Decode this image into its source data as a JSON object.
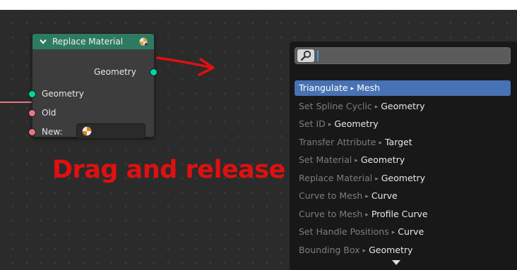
{
  "node": {
    "title": "Replace Material",
    "output_geometry": "Geometry",
    "input_geometry": "Geometry",
    "input_old": "Old",
    "input_new": "New:",
    "header_color": "#2e7b62",
    "geometry_socket_color": "#00d6a3",
    "material_socket_color": "#eb7582"
  },
  "annotation": {
    "text": "Drag and release",
    "color": "#e01010"
  },
  "search": {
    "query": "",
    "selected_color": "#4772b3",
    "results": [
      {
        "name": "Triangulate",
        "socket": "Mesh",
        "selected": true
      },
      {
        "name": "Set Spline Cyclic",
        "socket": "Geometry",
        "selected": false
      },
      {
        "name": "Set ID",
        "socket": "Geometry",
        "selected": false
      },
      {
        "name": "Transfer Attribute",
        "socket": "Target",
        "selected": false
      },
      {
        "name": "Set Material",
        "socket": "Geometry",
        "selected": false
      },
      {
        "name": "Replace Material",
        "socket": "Geometry",
        "selected": false
      },
      {
        "name": "Curve to Mesh",
        "socket": "Curve",
        "selected": false
      },
      {
        "name": "Curve to Mesh",
        "socket": "Profile Curve",
        "selected": false
      },
      {
        "name": "Set Handle Positions",
        "socket": "Curve",
        "selected": false
      },
      {
        "name": "Bounding Box",
        "socket": "Geometry",
        "selected": false
      }
    ]
  },
  "icons": {
    "collapse": "chevron-down-icon",
    "node_type": "material-node-icon",
    "search": "magnifier-icon",
    "material_preview": "material-ball-icon",
    "more_results": "triangle-down-icon"
  }
}
